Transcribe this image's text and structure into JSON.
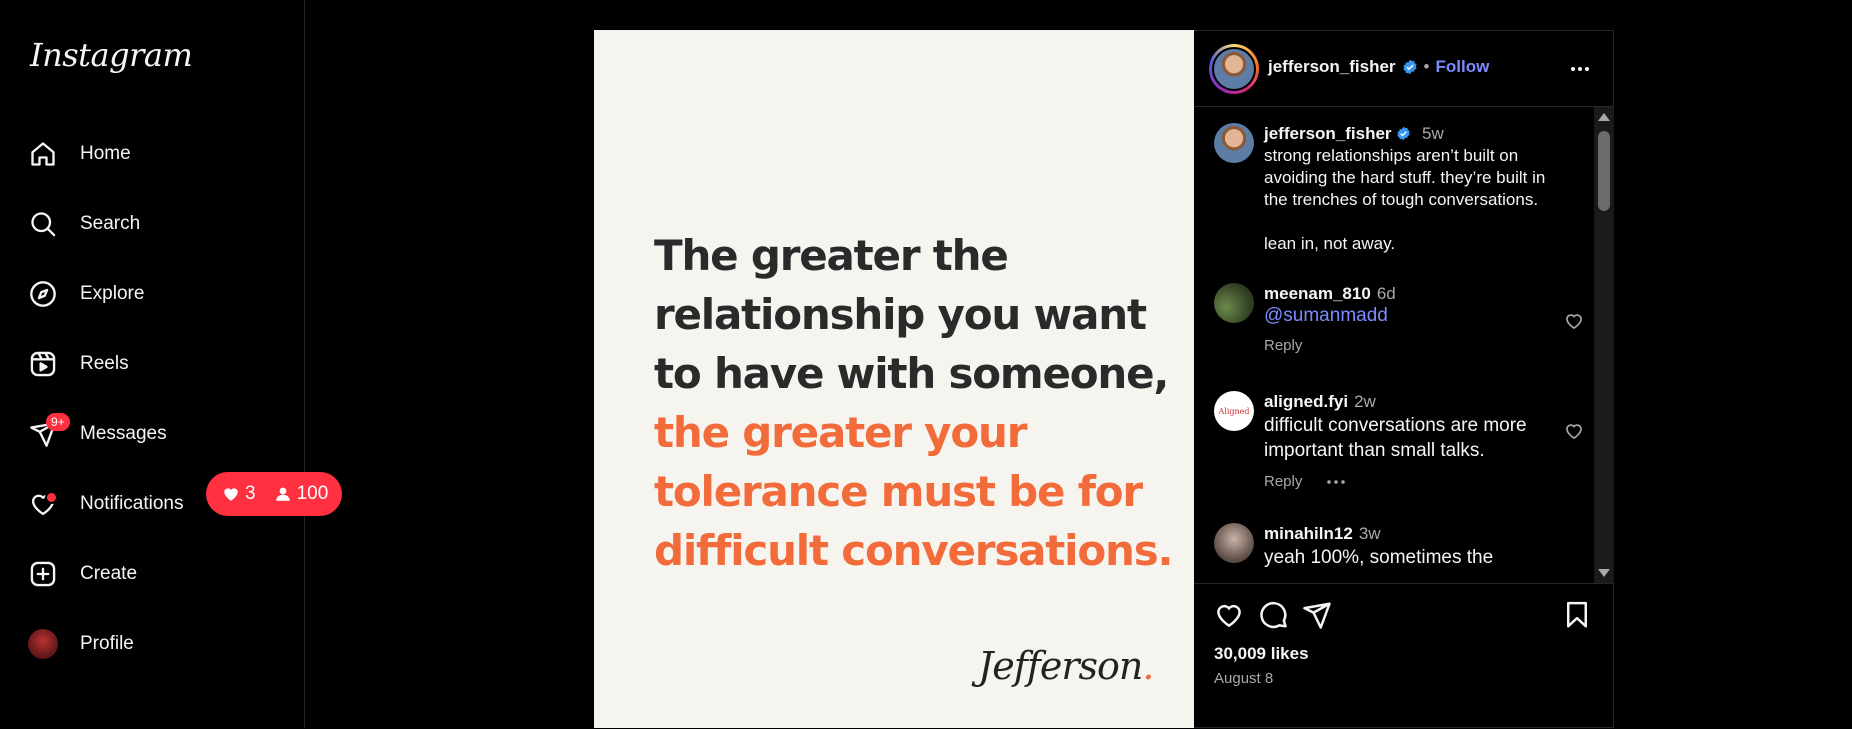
{
  "app": {
    "logo": "Instagram"
  },
  "sidebar": {
    "items": [
      {
        "label": "Home",
        "icon": "home-icon"
      },
      {
        "label": "Search",
        "icon": "search-icon"
      },
      {
        "label": "Explore",
        "icon": "compass-icon"
      },
      {
        "label": "Reels",
        "icon": "reels-icon"
      },
      {
        "label": "Messages",
        "icon": "paper-plane-icon",
        "badge": "9+"
      },
      {
        "label": "Notifications",
        "icon": "heart-icon"
      },
      {
        "label": "Create",
        "icon": "plus-square-icon"
      },
      {
        "label": "Profile",
        "icon": "avatar"
      }
    ],
    "notifications_popup": {
      "likes": "3",
      "follows": "100"
    }
  },
  "post": {
    "quote_dark": [
      "The greater the",
      "relationship you want",
      "to have with someone,"
    ],
    "quote_orange": [
      "the greater your",
      "tolerance must be for",
      "difficult conversations."
    ],
    "signature": "Jefferson",
    "signature_dot": ".",
    "author": "jefferson_fisher",
    "follow_label": "Follow",
    "separator": "•",
    "likes": "30,009 likes",
    "date": "August 8"
  },
  "caption": {
    "user": "jefferson_fisher",
    "time": "5w",
    "text": "strong relationships aren’t built on avoiding the hard stuff. they’re built in the trenches of tough conversations.\n\nlean in, not away."
  },
  "comments": [
    {
      "user": "meenam_810",
      "time": "6d",
      "mention": "@sumanmadd",
      "reply": "Reply"
    },
    {
      "user": "aligned.fyi",
      "time": "2w",
      "text": "difficult conversations are more important than small talks.",
      "reply": "Reply",
      "avatar_text": "Aligned"
    },
    {
      "user": "minahiln12",
      "time": "3w",
      "text": "yeah 100%, sometimes the"
    }
  ],
  "colors": {
    "accent_blue": "#7c8cff",
    "badge_red": "#ff3040",
    "quote_orange": "#f26b3a",
    "quote_dark": "#2a2a2a",
    "post_bg": "#f6f4ef"
  }
}
